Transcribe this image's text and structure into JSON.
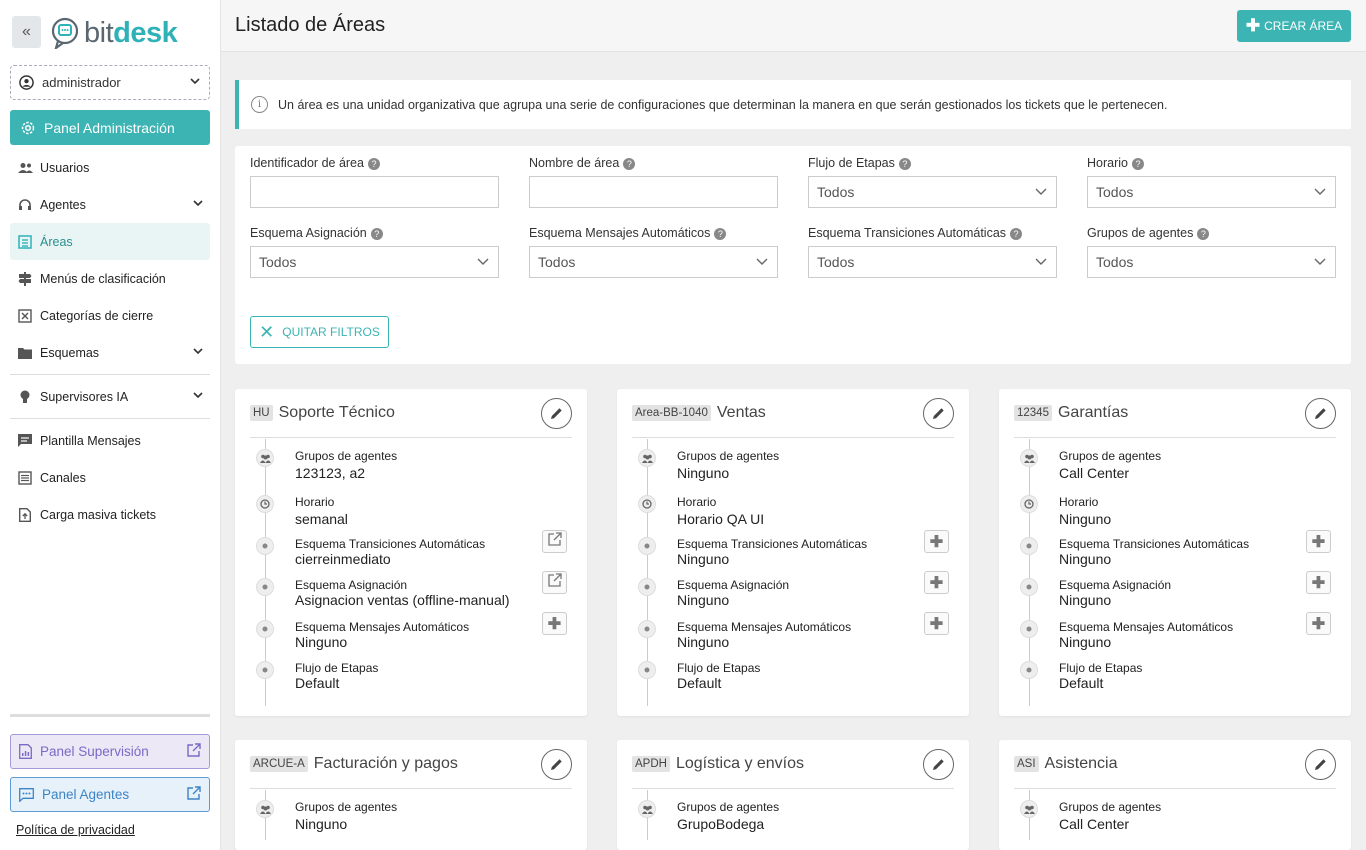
{
  "brand": {
    "bit": "bit",
    "desk": "desk"
  },
  "user": {
    "name": "administrador"
  },
  "sidebar": {
    "admin_label": "Panel Administración",
    "items": [
      {
        "label": "Usuarios"
      },
      {
        "label": "Agentes"
      },
      {
        "label": "Áreas"
      },
      {
        "label": "Menús de clasificación"
      },
      {
        "label": "Categorías de cierre"
      },
      {
        "label": "Esquemas"
      },
      {
        "label": "Supervisores IA"
      },
      {
        "label": "Plantilla Mensajes"
      },
      {
        "label": "Canales"
      },
      {
        "label": "Carga masiva tickets"
      }
    ],
    "panel_supervision": "Panel Supervisión",
    "panel_agentes": "Panel Agentes",
    "privacy": "Política de privacidad"
  },
  "header": {
    "title": "Listado de Áreas",
    "create_label": "CREAR ÁREA"
  },
  "info": {
    "text": "Un área es una unidad organizativa que agrupa una serie de configuraciones que determinan la manera en que serán gestionados los tickets que le pertenecen."
  },
  "filters": {
    "id_label": "Identificador de área",
    "name_label": "Nombre de área",
    "flow_label": "Flujo de Etapas",
    "flow_value": "Todos",
    "schedule_label": "Horario",
    "schedule_value": "Todos",
    "assign_label": "Esquema Asignación",
    "assign_value": "Todos",
    "msg_label": "Esquema Mensajes Automáticos",
    "msg_value": "Todos",
    "trans_label": "Esquema Transiciones Automáticas",
    "trans_value": "Todos",
    "groups_label": "Grupos de agentes",
    "groups_value": "Todos",
    "clear_label": "QUITAR FILTROS"
  },
  "field_labels": {
    "groups": "Grupos de agentes",
    "schedule": "Horario",
    "transitions": "Esquema Transiciones Automáticas",
    "assign": "Esquema Asignación",
    "messages": "Esquema Mensajes Automáticos",
    "flow": "Flujo de Etapas"
  },
  "cards": [
    {
      "code": "HU",
      "name": "Soporte Técnico",
      "groups": "123123, a2",
      "schedule": "semanal",
      "transitions": "cierreinmediato",
      "assign": "Asignacion ventas (offline-manual)",
      "messages": "Ninguno",
      "flow": "Default"
    },
    {
      "code": "Area-BB-1040",
      "name": "Ventas",
      "groups": "Ninguno",
      "schedule": "Horario QA UI",
      "transitions": "Ninguno",
      "assign": "Ninguno",
      "messages": "Ninguno",
      "flow": "Default"
    },
    {
      "code": "12345",
      "name": "Garantías",
      "groups": "Call Center",
      "schedule": "Ninguno",
      "transitions": "Ninguno",
      "assign": "Ninguno",
      "messages": "Ninguno",
      "flow": "Default"
    },
    {
      "code": "ARCUE-A",
      "name": "Facturación y pagos",
      "groups": "Ninguno"
    },
    {
      "code": "APDH",
      "name": "Logística y envíos",
      "groups": "GrupoBodega"
    },
    {
      "code": "ASI",
      "name": "Asistencia",
      "groups": "Call Center"
    }
  ],
  "colors": {
    "accent": "#3cb4b3",
    "supervision": "#7a6ac6",
    "agents": "#3d84c6"
  }
}
